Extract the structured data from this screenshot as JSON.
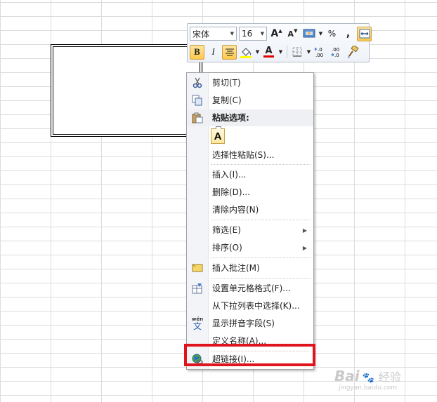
{
  "minibar": {
    "font_name": "宋体",
    "font_size": "16",
    "grow_font": "A",
    "shrink_font": "A",
    "percent": "%",
    "comma": ",",
    "bold": "B",
    "italic": "I",
    "font_color_letter": "A",
    "dec_inc": "←.0\n.00",
    "dec_dec": ".00\n→.0"
  },
  "menu": {
    "cut": "剪切(T)",
    "copy": "复制(C)",
    "paste_options": "粘贴选项:",
    "paste_a": "A",
    "paste_special": "选择性粘贴(S)...",
    "insert": "插入(I)...",
    "delete": "删除(D)...",
    "clear": "清除内容(N)",
    "filter": "筛选(E)",
    "sort": "排序(O)",
    "insert_comment": "插入批注(M)",
    "format_cells": "设置单元格格式(F)...",
    "pick_list": "从下拉列表中选择(K)...",
    "phonetic": "显示拼音字段(S)",
    "define_name": "定义名称(A)...",
    "hyperlink": "超链接(I)...",
    "phonetic_icon_text": "wén",
    "phonetic_icon_char": "文"
  },
  "colors": {
    "highlight_box": "#e0141c",
    "active_button": "#ffc84a",
    "font_color_bar": "#e00000",
    "fill_color_bar": "#ffff00"
  },
  "watermark": {
    "brand": "Bai",
    "word": "经验",
    "url": "jingyan.baidu.com"
  }
}
